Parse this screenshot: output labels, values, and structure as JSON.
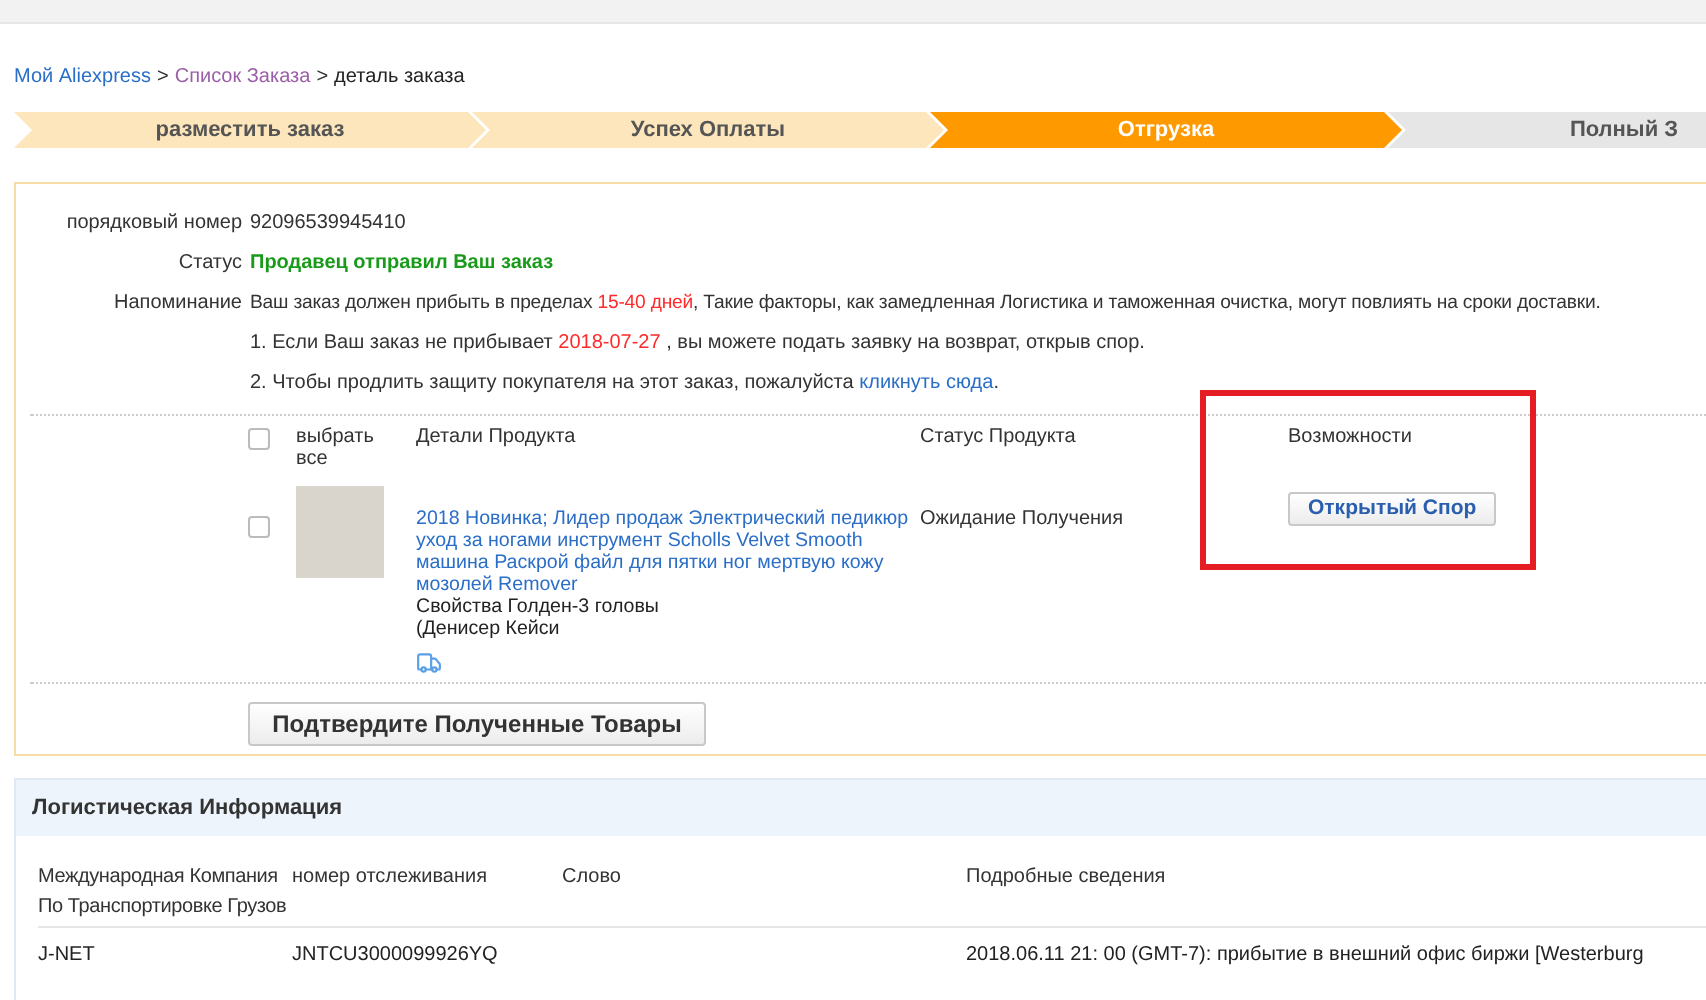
{
  "breadcrumb": {
    "separator": ">",
    "items": [
      {
        "label": "Мой Aliexpress",
        "kind": "link"
      },
      {
        "label": "Список Заказа",
        "kind": "visited"
      },
      {
        "label": "деталь заказа",
        "kind": "current"
      }
    ]
  },
  "steps": [
    {
      "label": "разместить заказ",
      "completed": true,
      "selected": false
    },
    {
      "label": "Успех Оплаты",
      "completed": true,
      "selected": false
    },
    {
      "label": "Отгрузка",
      "completed": false,
      "selected": true
    },
    {
      "label": "Полный З",
      "completed": false,
      "selected": false
    }
  ],
  "order": {
    "number_label": "порядковый номер",
    "number": "92096539945410",
    "status_label": "Статус",
    "status": "Продавец отправил Ваш заказ",
    "reminder_label": "Напоминание",
    "reminder": "Ваш заказ должен прибыть в пределах **15-40 дней**, Такие факторы, как замедленная Логистика и таможенная очистка, могут повлиять на сроки доставки.",
    "note_1": "1. Если Ваш заказ не прибывает **2018-07-27** , вы можете подать заявку на возврат, открыв спор.",
    "note_2": "2. Чтобы продлить защиту покупателя на этот заказ, пожалуйста",
    "note_2_link": "кликнуть сюда",
    "note_2_end": "."
  },
  "products": {
    "select_all": {
      "label": "выбрать все",
      "checked": false
    },
    "columns": [
      "Детали Продукта",
      "Статус Продукта",
      "Возможности"
    ],
    "rows": [
      {
        "checked": false,
        "title": "2018 Новинка; Лидер продаж Электрический педикюр уход за ногами инструмент Scholls Velvet Smooth машина Раскрой файл для пятки ног мертвую кожу мозолей Remover",
        "properties": "Свойства Голден-3 головы\n(Денисер Кейси",
        "status": "Ожидание Получения",
        "action": "Открытый Спор",
        "highlighted": true
      }
    ],
    "confirm_button": "Подтвердите Полученные Товары"
  },
  "logistics": {
    "title": "Логистическая Информация",
    "columns": [
      "Международная Компания По Транспортировке Грузов",
      "номер отслеживания",
      "Слово",
      "Подробные сведения"
    ],
    "rows": [
      [
        "J-NET",
        "JNTCU3000099926YQ",
        "",
        "2018.06.11 21: 00 (GMT-7): прибытие в внешний офис биржи [Westerburg"
      ]
    ]
  }
}
